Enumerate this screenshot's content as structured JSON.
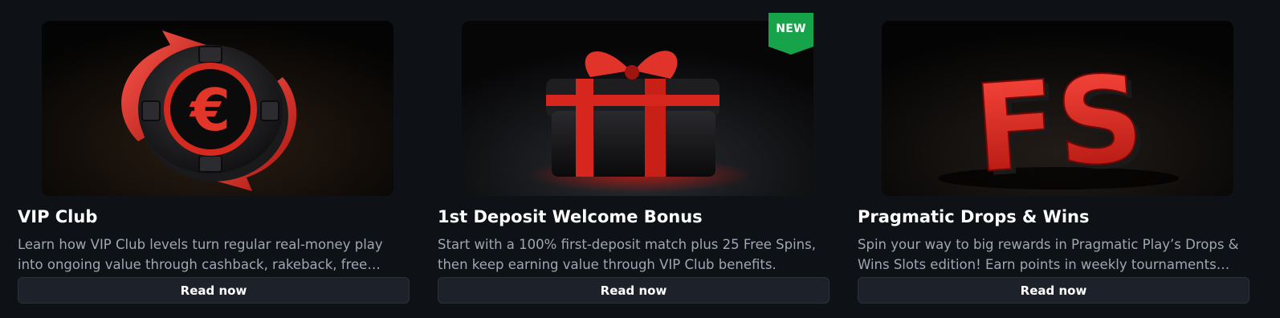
{
  "badge_color": "#16a34a",
  "cards": [
    {
      "image_icon": "vip-chip-euro",
      "title": "VIP Club",
      "description": "Learn how VIP Club levels turn regular real-money play into ongoing value through cashback, rakeback, free spins,...",
      "button_label": "Read now"
    },
    {
      "image_icon": "gift-box",
      "badge": "NEW",
      "title": "1st Deposit Welcome Bonus",
      "description": "Start with a 100% first-deposit match plus 25 Free Spins, then keep earning value through VIP Club benefits.",
      "button_label": "Read now"
    },
    {
      "image_icon": "fs-letters",
      "title": "Pragmatic Drops & Wins",
      "description": "Spin your way to big rewards in Pragmatic Play’s Drops & Wins Slots edition! Earn points in weekly tournaments and...",
      "button_label": "Read now"
    }
  ]
}
